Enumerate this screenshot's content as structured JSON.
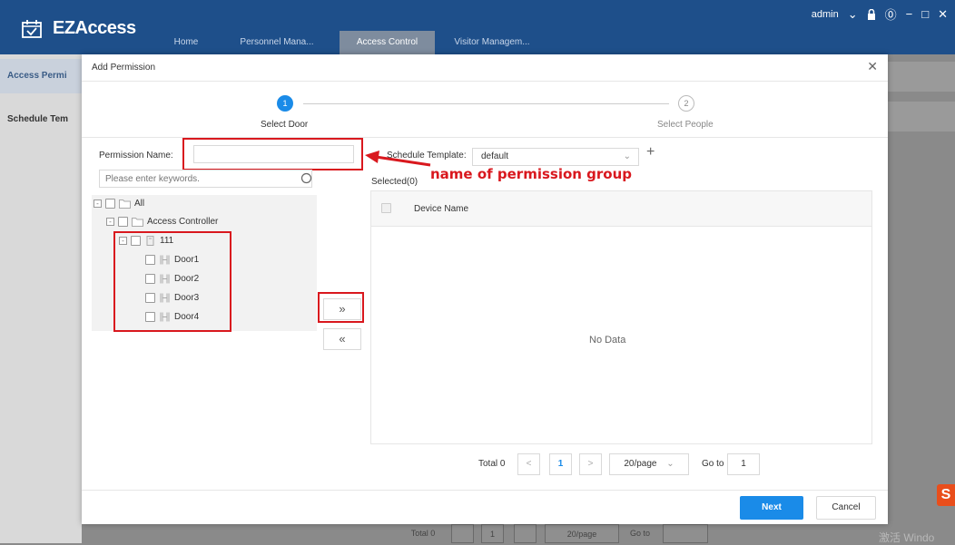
{
  "app": {
    "name": "EZAccess"
  },
  "nav": {
    "tabs": [
      {
        "label": "Home"
      },
      {
        "label": "Personnel Mana..."
      },
      {
        "label": "Access Control"
      },
      {
        "label": "Visitor Managem..."
      }
    ]
  },
  "header": {
    "user": "admin",
    "user_menu_icon": "chevron-down-icon",
    "lock_icon": "lock-icon",
    "help_icon": "help-icon"
  },
  "sidebar": {
    "items": [
      {
        "label": "Access Permi"
      },
      {
        "label": "Schedule Tem"
      }
    ]
  },
  "background_pager": {
    "total": "Total 0",
    "page": "1",
    "per_page": "20/page",
    "goto": "Go to"
  },
  "watermark": "激活 Windo",
  "badge": "S",
  "dialog": {
    "title": "Add Permission",
    "steps": [
      {
        "number": "1",
        "label": "Select Door"
      },
      {
        "number": "2",
        "label": "Select People"
      }
    ],
    "permission_name_label": "Permission Name:",
    "permission_name_value": "",
    "search_placeholder": "Please enter keywords.",
    "schedule_template_label": "Schedule Template:",
    "schedule_template_value": "default",
    "selected_label": "Selected(0)",
    "annotation": "name of permission group",
    "tree": [
      {
        "label": "All",
        "level": 0
      },
      {
        "label": "Access Controller",
        "level": 1
      },
      {
        "label": "111",
        "level": 2
      },
      {
        "label": "Door1",
        "level": 3
      },
      {
        "label": "Door2",
        "level": 3
      },
      {
        "label": "Door3",
        "level": 3
      },
      {
        "label": "Door4",
        "level": 3
      }
    ],
    "move_right": "»",
    "move_left": "«",
    "table": {
      "column": "Device Name",
      "empty": "No Data"
    },
    "pager": {
      "total": "Total 0",
      "prev": "<",
      "page": "1",
      "next": ">",
      "per_page": "20/page",
      "goto_label": "Go to",
      "goto_value": "1"
    },
    "next_button": "Next",
    "cancel_button": "Cancel"
  },
  "colors": {
    "header_bg": "#1e4f8a",
    "primary": "#1a8be8",
    "annotation": "#d9181e"
  }
}
